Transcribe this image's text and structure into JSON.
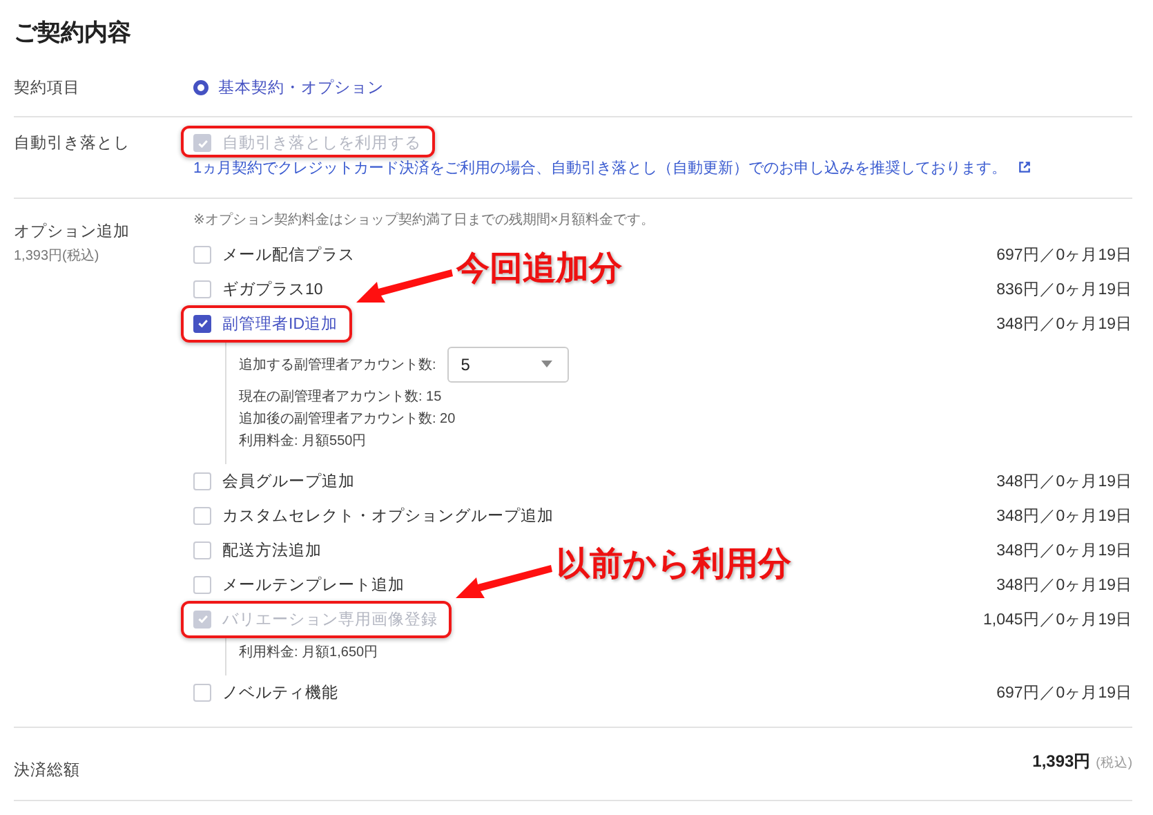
{
  "title": "ご契約内容",
  "contract_item": {
    "label": "契約項目",
    "options": [
      {
        "label": "基本契約・オプション",
        "selected": true
      }
    ]
  },
  "auto_debit": {
    "label": "自動引き落とし",
    "checkbox": {
      "label": "自動引き落としを利用する",
      "checked": true,
      "disabled": true,
      "highlighted": true
    },
    "note": "1ヵ月契約でクレジットカード決済をご利用の場合、自動引き落とし（自動更新）でのお申し込みを推奨しております。"
  },
  "options": {
    "label": "オプション追加",
    "sublabel": "1,393円(税込)",
    "note": "※オプション契約料金はショップ契約満了日までの残期間×月額料金です。",
    "items": [
      {
        "label": "メール配信プラス",
        "price": "697円／0ヶ月19日",
        "checked": false,
        "disabled": false,
        "highlighted": false
      },
      {
        "label": "ギガプラス10",
        "price": "836円／0ヶ月19日",
        "checked": false,
        "disabled": false,
        "highlighted": false
      },
      {
        "label": "副管理者ID追加",
        "price": "348円／0ヶ月19日",
        "checked": true,
        "disabled": false,
        "highlighted": true,
        "callout": "今回追加分",
        "details": {
          "select": {
            "label": "追加する副管理者アカウント数:",
            "value": "5"
          },
          "lines": [
            "現在の副管理者アカウント数: 15",
            "追加後の副管理者アカウント数: 20",
            "利用料金: 月額550円"
          ]
        }
      },
      {
        "label": "会員グループ追加",
        "price": "348円／0ヶ月19日",
        "checked": false,
        "disabled": false,
        "highlighted": false
      },
      {
        "label": "カスタムセレクト・オプショングループ追加",
        "price": "348円／0ヶ月19日",
        "checked": false,
        "disabled": false,
        "highlighted": false
      },
      {
        "label": "配送方法追加",
        "price": "348円／0ヶ月19日",
        "checked": false,
        "disabled": false,
        "highlighted": false
      },
      {
        "label": "メールテンプレート追加",
        "price": "348円／0ヶ月19日",
        "checked": false,
        "disabled": false,
        "highlighted": false
      },
      {
        "label": "バリエーション専用画像登録",
        "price": "1,045円／0ヶ月19日",
        "checked": true,
        "disabled": true,
        "highlighted": true,
        "callout": "以前から利用分",
        "details": {
          "lines": [
            "利用料金: 月額1,650円"
          ]
        }
      },
      {
        "label": "ノベルティ機能",
        "price": "697円／0ヶ月19日",
        "checked": false,
        "disabled": false,
        "highlighted": false
      }
    ]
  },
  "total": {
    "label": "決済総額",
    "amount": "1,393円",
    "tax_note": "(税込)"
  }
}
